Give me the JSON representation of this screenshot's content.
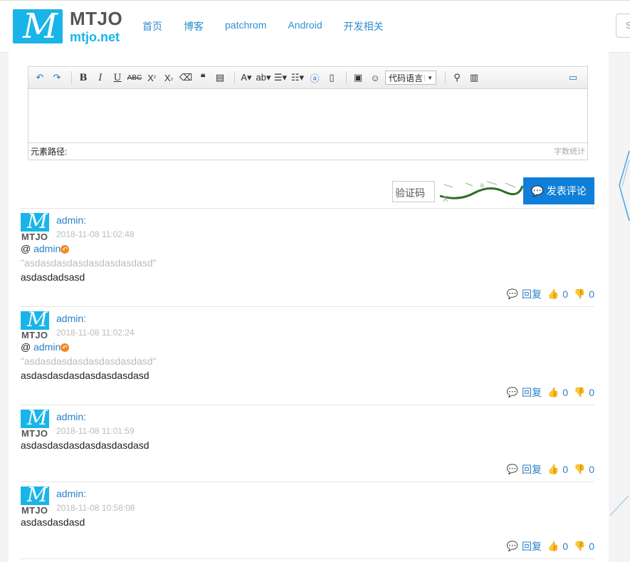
{
  "header": {
    "logo_top": "MTJO",
    "logo_bottom": "mtjo.net",
    "logo_glyph": "M",
    "nav": [
      "首页",
      "博客",
      "patchrom",
      "Android",
      "开发相关"
    ],
    "search_placeholder": "S"
  },
  "editor": {
    "code_language": "代码语言",
    "status_left": "元素路径:",
    "status_right": "字数统计"
  },
  "form": {
    "captcha_placeholder": "验证码",
    "submit_label": "发表评论"
  },
  "comments": [
    {
      "user": "admin:",
      "time": "2018-11-08 11:02:48",
      "reply_to": "admin",
      "quote": "\"asdasdasdasdasdasdasdasd\"",
      "text": "asdasdadsasd",
      "actions": {
        "reply": "回复",
        "up": "0",
        "down": "0"
      }
    },
    {
      "user": "admin:",
      "time": "2018-11-08 11:02:24",
      "reply_to": "admin",
      "quote": "\"asdasdasdasdasdasdasdasd\"",
      "text": "asdasdasdasdasdasdasdasd",
      "actions": {
        "reply": "回复",
        "up": "0",
        "down": "0"
      }
    },
    {
      "user": "admin:",
      "time": "2018-11-08 11:01:59",
      "text": "asdasdasdasdasdasdasdasd",
      "actions": {
        "reply": "回复",
        "up": "0",
        "down": "0"
      }
    },
    {
      "user": "admin:",
      "time": "2018-11-08 10:58:08",
      "text": "asdasdasdasd",
      "actions": {
        "reply": "回复",
        "up": "0",
        "down": "0"
      }
    }
  ],
  "avatar_label": "MTJO",
  "colors": {
    "brand": "#19b4e8",
    "link": "#2a80c9",
    "button": "#0f7fd9",
    "reply_badge": "#f08a24"
  }
}
